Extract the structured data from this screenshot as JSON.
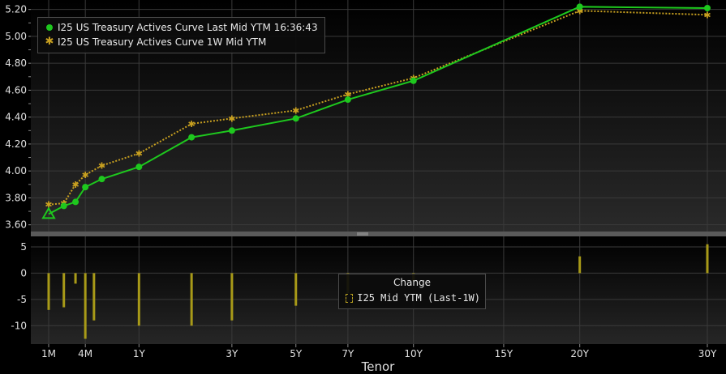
{
  "chart_data": [
    {
      "type": "line",
      "series": [
        {
          "name": "I25 US Treasury Actives Curve Last Mid YTM 16:36:43",
          "color": "#1ec81e",
          "points": [
            {
              "tenor": "1M",
              "value": 3.68
            },
            {
              "tenor": "2M",
              "value": 3.74
            },
            {
              "tenor": "3M",
              "value": 3.77
            },
            {
              "tenor": "4M",
              "value": 3.88
            },
            {
              "tenor": "6M",
              "value": 3.94
            },
            {
              "tenor": "1Y",
              "value": 4.03
            },
            {
              "tenor": "2Y",
              "value": 4.25
            },
            {
              "tenor": "3Y",
              "value": 4.3
            },
            {
              "tenor": "5Y",
              "value": 4.39
            },
            {
              "tenor": "7Y",
              "value": 4.53
            },
            {
              "tenor": "10Y",
              "value": 4.67
            },
            {
              "tenor": "20Y",
              "value": 5.22
            },
            {
              "tenor": "30Y",
              "value": 5.21
            }
          ]
        },
        {
          "name": "I25 US Treasury Actives Curve 1W Mid YTM",
          "color": "#c8a020",
          "points": [
            {
              "tenor": "1M",
              "value": 3.75
            },
            {
              "tenor": "2M",
              "value": 3.76
            },
            {
              "tenor": "3M",
              "value": 3.9
            },
            {
              "tenor": "4M",
              "value": 3.97
            },
            {
              "tenor": "6M",
              "value": 4.04
            },
            {
              "tenor": "1Y",
              "value": 4.13
            },
            {
              "tenor": "2Y",
              "value": 4.35
            },
            {
              "tenor": "3Y",
              "value": 4.39
            },
            {
              "tenor": "5Y",
              "value": 4.45
            },
            {
              "tenor": "7Y",
              "value": 4.57
            },
            {
              "tenor": "10Y",
              "value": 4.69
            },
            {
              "tenor": "20Y",
              "value": 5.19
            },
            {
              "tenor": "30Y",
              "value": 5.16
            }
          ]
        }
      ],
      "ylim": [
        3.55,
        5.27
      ],
      "yticks": [
        "3.60",
        "3.80",
        "4.00",
        "4.20",
        "4.40",
        "4.60",
        "4.80",
        "5.00",
        "5.20"
      ],
      "legend": "top-left",
      "grid": true
    },
    {
      "type": "bar",
      "series": [
        {
          "name": "I25 Mid YTM (Last-1W)",
          "color": "#a89a18",
          "points": [
            {
              "tenor": "1M",
              "value": -7.0
            },
            {
              "tenor": "2M",
              "value": -6.5
            },
            {
              "tenor": "3M",
              "value": -2.0
            },
            {
              "tenor": "4M",
              "value": -12.5
            },
            {
              "tenor": "5M",
              "value": -9.0
            },
            {
              "tenor": "1Y",
              "value": -10.0
            },
            {
              "tenor": "2Y",
              "value": -10.0
            },
            {
              "tenor": "3Y",
              "value": -9.0
            },
            {
              "tenor": "5Y",
              "value": -6.2
            },
            {
              "tenor": "7Y",
              "value": -3.8
            },
            {
              "tenor": "10Y",
              "value": -1.5
            },
            {
              "tenor": "20Y",
              "value": 3.2
            },
            {
              "tenor": "30Y",
              "value": 5.5
            }
          ]
        }
      ],
      "ylim": [
        -13.5,
        7
      ],
      "yticks": [
        "5",
        "0",
        "-5",
        "-10"
      ],
      "legend": "center",
      "legend_title": "Change",
      "grid": true
    }
  ],
  "x_axis": {
    "label": "Tenor",
    "ticks": [
      "1M",
      "4M",
      "1Y",
      "3Y",
      "5Y",
      "7Y",
      "10Y",
      "15Y",
      "20Y",
      "30Y"
    ]
  },
  "top_legend": {
    "line1": "I25 US Treasury Actives Curve Last Mid YTM 16:36:43",
    "line2": "I25 US Treasury Actives Curve 1W Mid YTM"
  },
  "bottom_legend": {
    "title": "Change",
    "entry": "I25 Mid YTM (Last-1W)"
  },
  "colors": {
    "background": "#000000",
    "grid": "#3a3a3a",
    "last": "#1ec81e",
    "week": "#c8a020",
    "change": "#a89a18",
    "axis_text": "#e0e0e0"
  }
}
